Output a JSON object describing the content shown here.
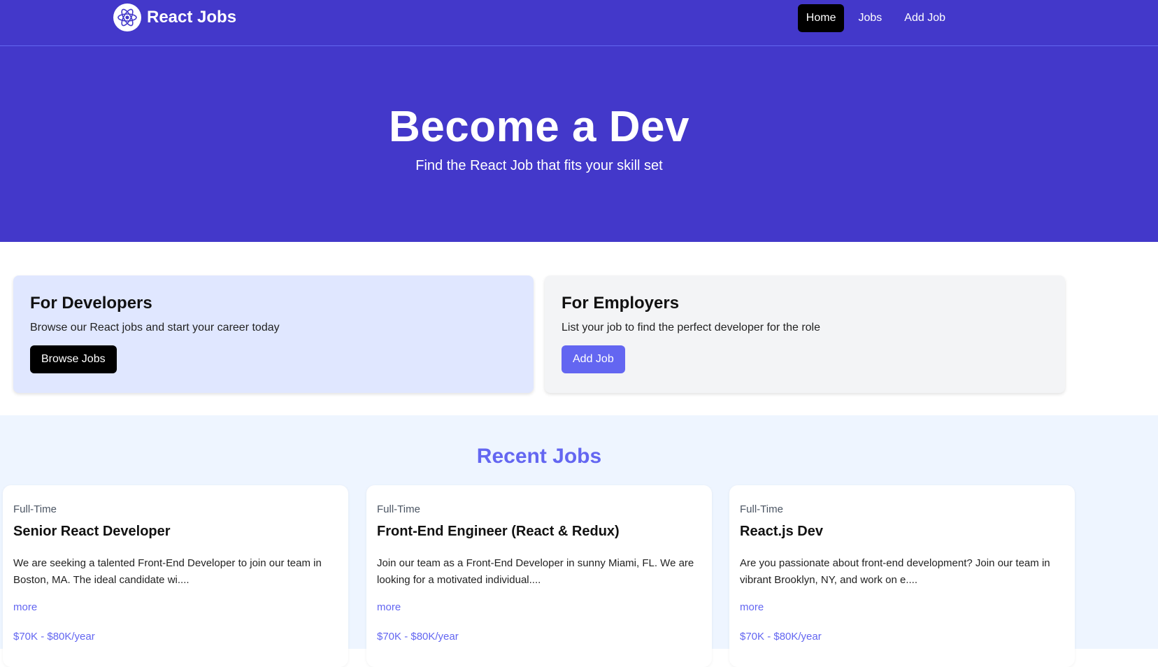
{
  "navbar": {
    "brand": "React Jobs",
    "links": [
      {
        "label": "Home",
        "active": true
      },
      {
        "label": "Jobs",
        "active": false
      },
      {
        "label": "Add Job",
        "active": false
      }
    ]
  },
  "hero": {
    "title": "Become a Dev",
    "subtitle": "Find the React Job that fits your skill set"
  },
  "promos": {
    "developers": {
      "title": "For Developers",
      "text": "Browse our React jobs and start your career today",
      "button": "Browse Jobs"
    },
    "employers": {
      "title": "For Employers",
      "text": "List your job to find the perfect developer for the role",
      "button": "Add Job"
    }
  },
  "recent_jobs": {
    "heading": "Recent Jobs",
    "jobs": [
      {
        "type": "Full-Time",
        "title": "Senior React Developer",
        "description": "We are seeking a talented Front-End Developer to join our team in Boston, MA. The ideal candidate wi....",
        "more": "more",
        "salary": "$70K - $80K/year"
      },
      {
        "type": "Full-Time",
        "title": "Front-End Engineer (React & Redux)",
        "description": "Join our team as a Front-End Developer in sunny Miami, FL. We are looking for a motivated individual....",
        "more": "more",
        "salary": "$70K - $80K/year"
      },
      {
        "type": "Full-Time",
        "title": "React.js Dev",
        "description": "Are you passionate about front-end development? Join our team in vibrant Brooklyn, NY, and work on e....",
        "more": "more",
        "salary": "$70K - $80K/year"
      }
    ]
  },
  "colors": {
    "primary": "#4338ca",
    "accent": "#6366f1",
    "dev_card_bg": "#e0e7ff",
    "emp_card_bg": "#f3f4f6",
    "jobs_bg": "#eef5ff"
  },
  "icons": {
    "brand_logo": "react-atom-icon"
  }
}
